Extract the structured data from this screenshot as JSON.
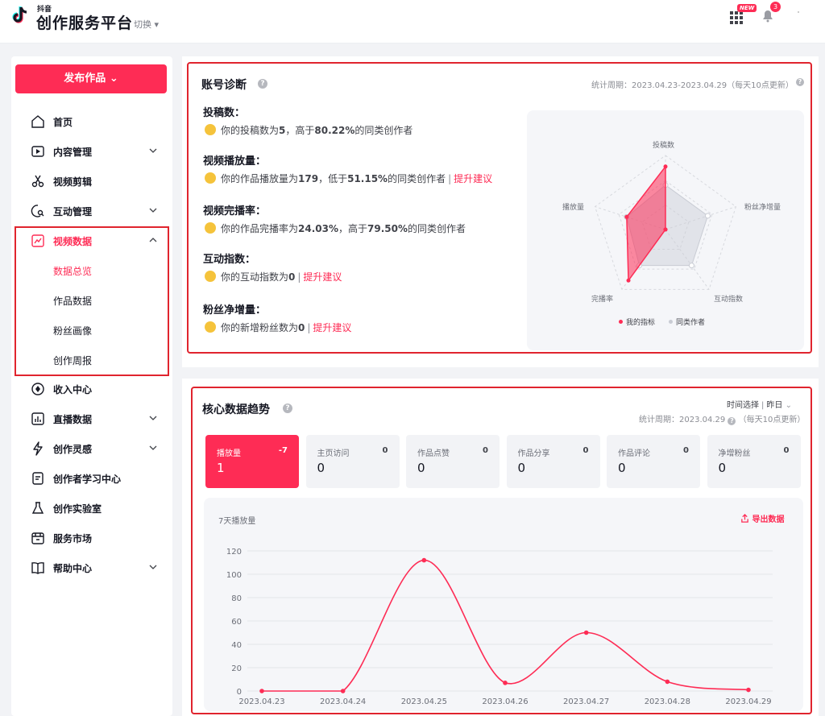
{
  "header": {
    "logo_small": "抖音",
    "logo_big": "创作服务平台",
    "switch_label": "切换",
    "new_badge": "NEW",
    "notification_count": "3"
  },
  "sidebar": {
    "publish_label": "发布作品",
    "items": [
      {
        "label": "首页",
        "icon": "home-icon"
      },
      {
        "label": "内容管理",
        "icon": "play-square-icon"
      },
      {
        "label": "视频剪辑",
        "icon": "scissors-icon"
      },
      {
        "label": "互动管理",
        "icon": "chat-search-icon"
      },
      {
        "label": "视频数据",
        "icon": "trend-chart-icon"
      },
      {
        "label": "收入中心",
        "icon": "coin-icon"
      },
      {
        "label": "直播数据",
        "icon": "bar-chart-icon"
      },
      {
        "label": "创作灵感",
        "icon": "lightning-icon"
      },
      {
        "label": "创作者学习中心",
        "icon": "document-icon"
      },
      {
        "label": "创作实验室",
        "icon": "flask-icon"
      },
      {
        "label": "服务市场",
        "icon": "store-icon"
      },
      {
        "label": "帮助中心",
        "icon": "book-icon"
      }
    ],
    "video_data_sub": [
      "数据总览",
      "作品数据",
      "粉丝画像",
      "创作周报"
    ]
  },
  "diagnosis": {
    "title": "账号诊断",
    "period": "统计周期：2023.04.23-2023.04.29（每天10点更新）",
    "items": [
      {
        "label": "投稿数：",
        "pre": "你的投稿数为",
        "value": "5",
        "mid": "，高于",
        "pct": "80.22%",
        "post": "的同类创作者",
        "advice": ""
      },
      {
        "label": "视频播放量：",
        "pre": "你的作品播放量为",
        "value": "179",
        "mid": "，低于",
        "pct": "51.15%",
        "post": "的同类创作者",
        "advice": "提升建议"
      },
      {
        "label": "视频完播率：",
        "pre": "你的作品完播率为",
        "value": "24.03%",
        "mid": "，高于",
        "pct": "79.50%",
        "post": "的同类创作者",
        "advice": ""
      },
      {
        "label": "互动指数：",
        "pre": "你的互动指数为",
        "value": "0",
        "mid": "",
        "pct": "",
        "post": "",
        "advice": "提升建议"
      },
      {
        "label": "粉丝净增量：",
        "pre": "你的新增粉丝数为",
        "value": "0",
        "mid": "",
        "pct": "",
        "post": "",
        "advice": "提升建议"
      }
    ],
    "radar": {
      "axes": [
        "投稿数",
        "粉丝净增量",
        "互动指数",
        "完播率",
        "播放量"
      ],
      "mine": [
        0.85,
        0.0,
        0.0,
        0.85,
        0.55
      ],
      "peers": [
        0.6,
        0.6,
        0.6,
        0.6,
        0.55
      ],
      "legend_mine": "我的指标",
      "legend_peers": "同类作者",
      "color_mine": "#fe2c55",
      "color_peers": "#c9ccd4"
    }
  },
  "trend": {
    "title": "核心数据趋势",
    "time_select": "时间选择",
    "time_value": "昨日",
    "period": "统计周期：2023.04.29",
    "period_note": "（每天10点更新）",
    "metrics": [
      {
        "label": "播放量",
        "delta": "-7",
        "value": "1",
        "active": true
      },
      {
        "label": "主页访问",
        "delta": "0",
        "value": "0",
        "active": false
      },
      {
        "label": "作品点赞",
        "delta": "0",
        "value": "0",
        "active": false
      },
      {
        "label": "作品分享",
        "delta": "0",
        "value": "0",
        "active": false
      },
      {
        "label": "作品评论",
        "delta": "0",
        "value": "0",
        "active": false
      },
      {
        "label": "净增粉丝",
        "delta": "0",
        "value": "0",
        "active": false
      }
    ],
    "chart_subtitle": "7天播放量",
    "export_label": "导出数据"
  },
  "chart_data": {
    "type": "line",
    "title": "7天播放量",
    "x": [
      "2023.04.23",
      "2023.04.24",
      "2023.04.25",
      "2023.04.26",
      "2023.04.27",
      "2023.04.28",
      "2023.04.29"
    ],
    "series": [
      {
        "values": [
          0,
          0,
          112,
          7,
          50,
          8,
          1
        ]
      }
    ],
    "yticks": [
      0,
      20,
      40,
      60,
      80,
      100,
      120
    ],
    "ylim": [
      0,
      120
    ],
    "color": "#fe2c55",
    "grid": true
  }
}
